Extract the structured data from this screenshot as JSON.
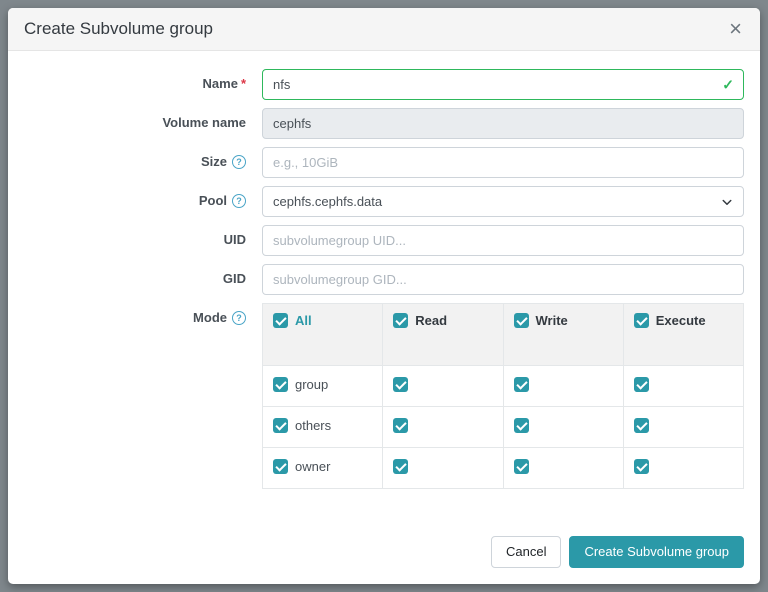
{
  "modal": {
    "title": "Create Subvolume group",
    "close_glyph": "×"
  },
  "icons": {
    "help": "?",
    "valid_check": "✓"
  },
  "form": {
    "name": {
      "label": "Name",
      "required_marker": "*",
      "value": "nfs"
    },
    "volume_name": {
      "label": "Volume name",
      "value": "cephfs"
    },
    "size": {
      "label": "Size",
      "placeholder": "e.g., 10GiB"
    },
    "pool": {
      "label": "Pool",
      "value": "cephfs.cephfs.data"
    },
    "uid": {
      "label": "UID",
      "placeholder": "subvolumegroup UID..."
    },
    "gid": {
      "label": "GID",
      "placeholder": "subvolumegroup GID..."
    },
    "mode": {
      "label": "Mode"
    },
    "mode_table": {
      "columns": [
        "All",
        "Read",
        "Write",
        "Execute"
      ],
      "rows": [
        "group",
        "others",
        "owner"
      ],
      "all_checked": true
    }
  },
  "footer": {
    "cancel_label": "Cancel",
    "submit_label": "Create Subvolume group"
  },
  "colors": {
    "accent": "#2b99a8",
    "valid_green": "#2eb85c",
    "required_red": "#dc3545",
    "help_blue": "#49a4c7"
  }
}
